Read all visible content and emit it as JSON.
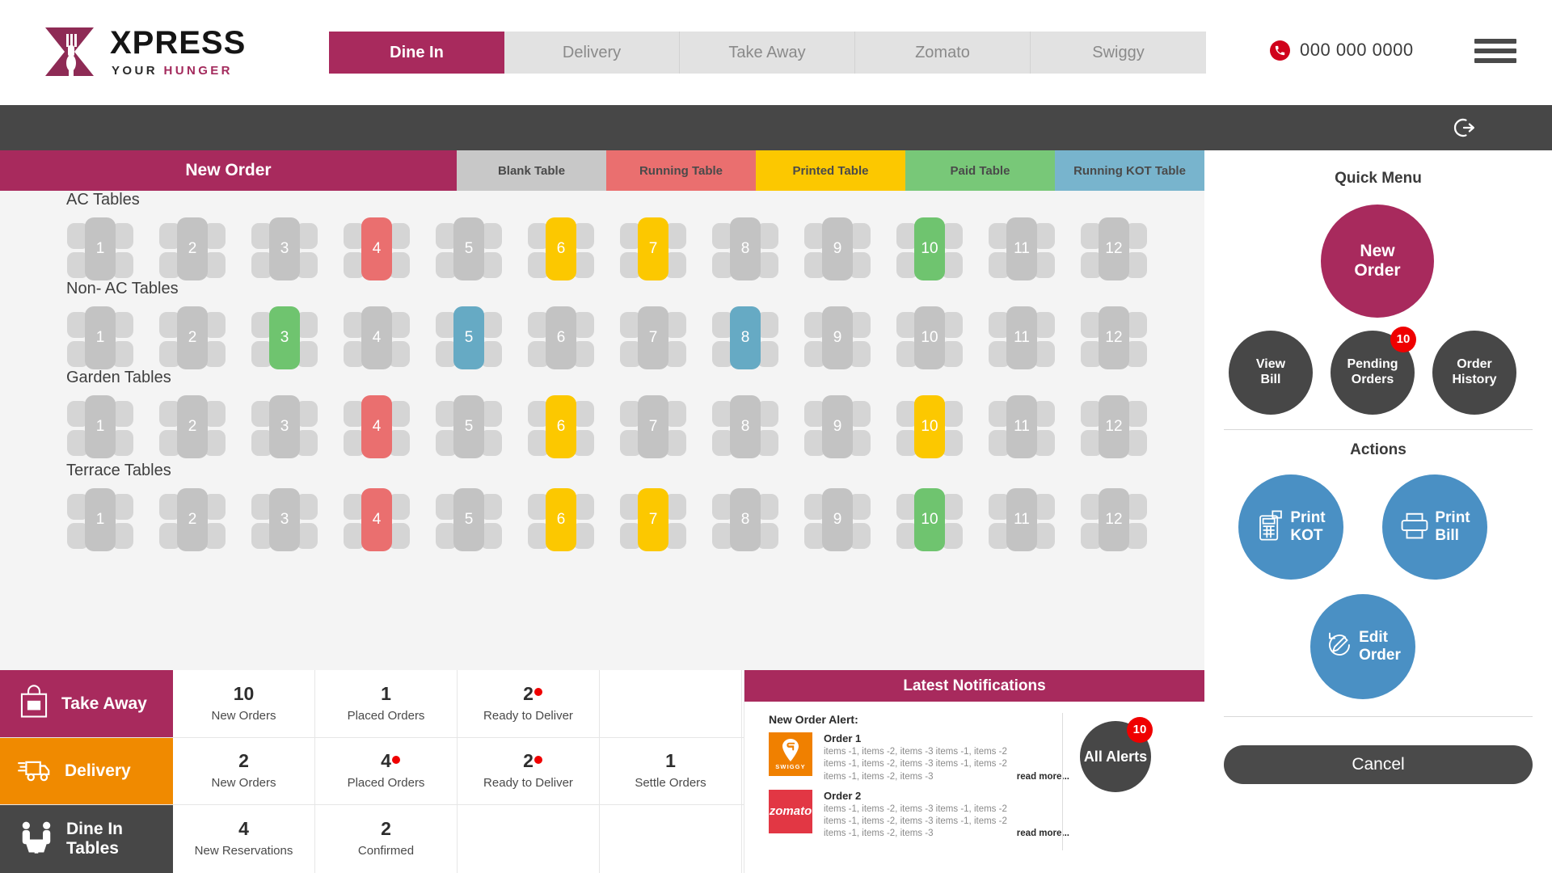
{
  "brand": {
    "title": "XPRESS",
    "sub_your": "YOUR",
    "sub_hunger": "HUNGER"
  },
  "header": {
    "tabs": [
      {
        "label": "Dine In",
        "active": true
      },
      {
        "label": "Delivery",
        "active": false
      },
      {
        "label": "Take Away",
        "active": false
      },
      {
        "label": "Zomato",
        "active": false
      },
      {
        "label": "Swiggy",
        "active": false
      }
    ],
    "phone": "000 000 0000",
    "phone_icon": "phone-icon",
    "menu_icon": "hamburger-menu-icon"
  },
  "darkbar": {
    "logout_icon": "logout-icon"
  },
  "legend": {
    "main_label": "New Order",
    "items": [
      {
        "label": "Blank Table",
        "color": "#c8c8c8"
      },
      {
        "label": "Running Table",
        "color": "#ea6f6f"
      },
      {
        "label": "Printed Table",
        "color": "#fcc800"
      },
      {
        "label": "Paid Table",
        "color": "#78c878"
      },
      {
        "label": "Running KOT Table",
        "color": "#78b4cd"
      }
    ]
  },
  "tables": {
    "sections": [
      {
        "title": "AC Tables",
        "items": [
          {
            "num": "1",
            "state": "blank"
          },
          {
            "num": "2",
            "state": "blank"
          },
          {
            "num": "3",
            "state": "blank"
          },
          {
            "num": "4",
            "state": "running"
          },
          {
            "num": "5",
            "state": "blank"
          },
          {
            "num": "6",
            "state": "printed"
          },
          {
            "num": "7",
            "state": "printed"
          },
          {
            "num": "8",
            "state": "blank"
          },
          {
            "num": "9",
            "state": "blank"
          },
          {
            "num": "10",
            "state": "paid"
          },
          {
            "num": "11",
            "state": "blank"
          },
          {
            "num": "12",
            "state": "blank"
          }
        ]
      },
      {
        "title": "Non- AC Tables",
        "items": [
          {
            "num": "1",
            "state": "blank"
          },
          {
            "num": "2",
            "state": "blank"
          },
          {
            "num": "3",
            "state": "paid"
          },
          {
            "num": "4",
            "state": "blank"
          },
          {
            "num": "5",
            "state": "kot"
          },
          {
            "num": "6",
            "state": "blank"
          },
          {
            "num": "7",
            "state": "blank"
          },
          {
            "num": "8",
            "state": "kot"
          },
          {
            "num": "9",
            "state": "blank"
          },
          {
            "num": "10",
            "state": "blank"
          },
          {
            "num": "11",
            "state": "blank"
          },
          {
            "num": "12",
            "state": "blank"
          }
        ]
      },
      {
        "title": "Garden Tables",
        "items": [
          {
            "num": "1",
            "state": "blank"
          },
          {
            "num": "2",
            "state": "blank"
          },
          {
            "num": "3",
            "state": "blank"
          },
          {
            "num": "4",
            "state": "running"
          },
          {
            "num": "5",
            "state": "blank"
          },
          {
            "num": "6",
            "state": "printed"
          },
          {
            "num": "7",
            "state": "blank"
          },
          {
            "num": "8",
            "state": "blank"
          },
          {
            "num": "9",
            "state": "blank"
          },
          {
            "num": "10",
            "state": "printed"
          },
          {
            "num": "11",
            "state": "blank"
          },
          {
            "num": "12",
            "state": "blank"
          }
        ]
      },
      {
        "title": "Terrace Tables",
        "items": [
          {
            "num": "1",
            "state": "blank"
          },
          {
            "num": "2",
            "state": "blank"
          },
          {
            "num": "3",
            "state": "blank"
          },
          {
            "num": "4",
            "state": "running"
          },
          {
            "num": "5",
            "state": "blank"
          },
          {
            "num": "6",
            "state": "printed"
          },
          {
            "num": "7",
            "state": "printed"
          },
          {
            "num": "8",
            "state": "blank"
          },
          {
            "num": "9",
            "state": "blank"
          },
          {
            "num": "10",
            "state": "paid"
          },
          {
            "num": "11",
            "state": "blank"
          },
          {
            "num": "12",
            "state": "blank"
          }
        ]
      }
    ]
  },
  "stats": {
    "rows": [
      {
        "label": "Take Away",
        "icon": "takeaway-bag-icon",
        "color": "#a82a5d",
        "cells": [
          {
            "num": "10",
            "label": "New Orders",
            "dot": false
          },
          {
            "num": "1",
            "label": "Placed Orders",
            "dot": false
          },
          {
            "num": "2",
            "label": "Ready to Deliver",
            "dot": true
          },
          {
            "num": "",
            "label": "",
            "dot": false
          }
        ]
      },
      {
        "label": "Delivery",
        "icon": "delivery-truck-icon",
        "color": "#f08a00",
        "cells": [
          {
            "num": "2",
            "label": "New Orders",
            "dot": false
          },
          {
            "num": "4",
            "label": "Placed Orders",
            "dot": true
          },
          {
            "num": "2",
            "label": "Ready to Deliver",
            "dot": true
          },
          {
            "num": "1",
            "label": "Settle Orders",
            "dot": false
          }
        ]
      },
      {
        "label": "Dine In Tables",
        "icon": "dine-in-people-icon",
        "color": "#474747",
        "cells": [
          {
            "num": "4",
            "label": "New Reservations",
            "dot": false
          },
          {
            "num": "2",
            "label": "Confirmed",
            "dot": false
          },
          {
            "num": "",
            "label": "",
            "dot": false
          },
          {
            "num": "",
            "label": "",
            "dot": false
          }
        ]
      }
    ]
  },
  "notifications": {
    "title": "Latest Notifications",
    "alert_label": "New Order Alert:",
    "items": [
      {
        "brand": "swiggy",
        "brand_name": "SWIGGY",
        "order": "Order 1",
        "lines": [
          "items -1, items -2, items -3 items -1, items -2",
          "items -1, items -2, items -3 items -1, items -2",
          "items -1, items -2, items -3"
        ],
        "read_more": "read more..."
      },
      {
        "brand": "zomato",
        "brand_name": "zomato",
        "order": "Order 2",
        "lines": [
          "items -1, items -2, items -3 items -1, items -2",
          "items -1, items -2, items -3 items -1, items -2",
          "items -1, items -2, items -3"
        ],
        "read_more": "read more..."
      }
    ],
    "all_alerts_label": "All Alerts",
    "all_alerts_badge": "10"
  },
  "sidebar": {
    "quick_menu_title": "Quick Menu",
    "new_order": "New Order",
    "quick_items": [
      {
        "label": "View Bill",
        "badge": ""
      },
      {
        "label": "Pending Orders",
        "badge": "10"
      },
      {
        "label": "Order History",
        "badge": ""
      }
    ],
    "actions_title": "Actions",
    "actions": [
      {
        "label": "Print KOT",
        "icon": "pos-terminal-icon"
      },
      {
        "label": "Print Bill",
        "icon": "printer-icon"
      },
      {
        "label": "Edit Order",
        "icon": "edit-pencil-circle-icon"
      }
    ],
    "cancel": "Cancel"
  },
  "colors": {
    "brand_magenta": "#a82a5d",
    "orange": "#f08a00",
    "dark": "#474747",
    "action_blue": "#4a90c4",
    "alert_red": "#ef0000"
  }
}
